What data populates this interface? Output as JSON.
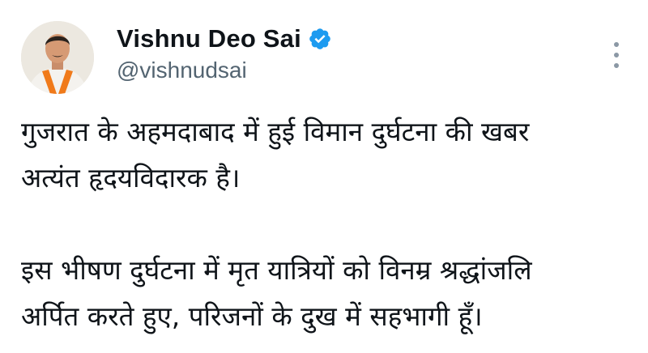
{
  "author": {
    "display_name": "Vishnu Deo Sai",
    "handle": "@vishnudsai",
    "verified": true,
    "verified_color": "#1d9bf0",
    "avatar_icon": "profile-photo"
  },
  "menu": {
    "icon": "more-vertical-icon"
  },
  "tweet": {
    "paragraphs": [
      "गुजरात के अहमदाबाद में हुई विमान दुर्घटना की खबर\nअत्यंत हृदयविदारक है।",
      "इस भीषण दुर्घटना में मृत यात्रियों को विनम्र श्रद्धांजलि\nअर्पित करते हुए, परिजनों के दुख में सहभागी हूँ।"
    ]
  }
}
